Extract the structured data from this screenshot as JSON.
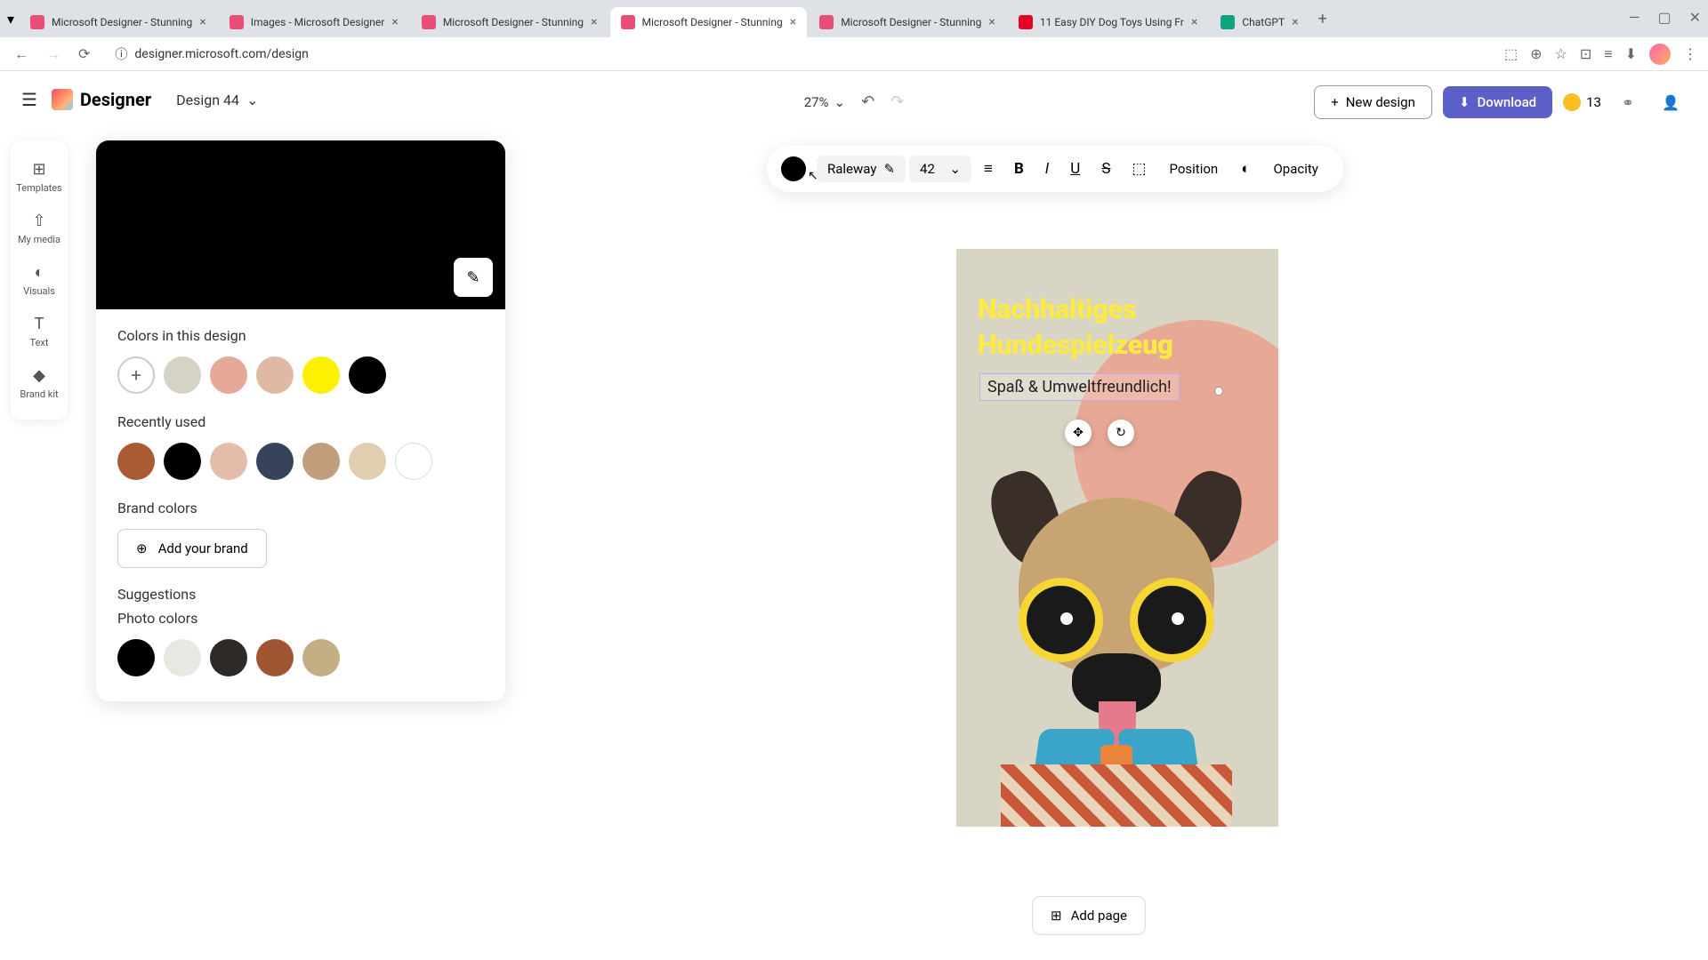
{
  "browser": {
    "tabs": [
      {
        "title": "Microsoft Designer - Stunning",
        "favicon": "designer"
      },
      {
        "title": "Images - Microsoft Designer",
        "favicon": "designer"
      },
      {
        "title": "Microsoft Designer - Stunning",
        "favicon": "designer"
      },
      {
        "title": "Microsoft Designer - Stunning",
        "favicon": "designer",
        "active": true
      },
      {
        "title": "Microsoft Designer - Stunning",
        "favicon": "designer"
      },
      {
        "title": "11 Easy DIY Dog Toys Using Fr",
        "favicon": "pin"
      },
      {
        "title": "ChatGPT",
        "favicon": "gpt"
      }
    ],
    "url": "designer.microsoft.com/design"
  },
  "app": {
    "logo_text": "Designer",
    "doc_name": "Design 44",
    "zoom": "27%",
    "new_design": "New design",
    "download": "Download",
    "credits": "13",
    "rail": [
      {
        "icon": "⊞",
        "label": "Templates"
      },
      {
        "icon": "⇧",
        "label": "My media"
      },
      {
        "icon": "◐",
        "label": "Visuals"
      },
      {
        "icon": "T",
        "label": "Text"
      },
      {
        "icon": "◆",
        "label": "Brand kit"
      }
    ]
  },
  "color_panel": {
    "current": "#000000",
    "sections": {
      "in_design": {
        "label": "Colors in this design",
        "colors": [
          "add",
          "#d5d3c5",
          "#e6a999",
          "#dfb9a3",
          "#fdf100",
          "#000000"
        ]
      },
      "recent": {
        "label": "Recently used",
        "colors": [
          "#a95b34",
          "#000000",
          "#e3bda9",
          "#36435a",
          "#c29e7d",
          "#e1cdb0",
          "#ffffff"
        ]
      },
      "brand": {
        "label": "Brand colors",
        "button": "Add your brand"
      },
      "suggestions": {
        "label": "Suggestions"
      },
      "photo": {
        "label": "Photo colors",
        "colors": [
          "#000000",
          "#e9e7e1",
          "#2d2a28",
          "#a15633",
          "#c4ae83"
        ]
      }
    }
  },
  "text_toolbar": {
    "color": "#000000",
    "font": "Raleway",
    "size": "42",
    "position": "Position",
    "opacity": "Opacity"
  },
  "canvas": {
    "title_line1": "Nachhaltiges",
    "title_line2": "Hundespielzeug",
    "subtitle": "Spaß & Umweltfreundlich!"
  },
  "footer": {
    "add_page": "Add page"
  }
}
